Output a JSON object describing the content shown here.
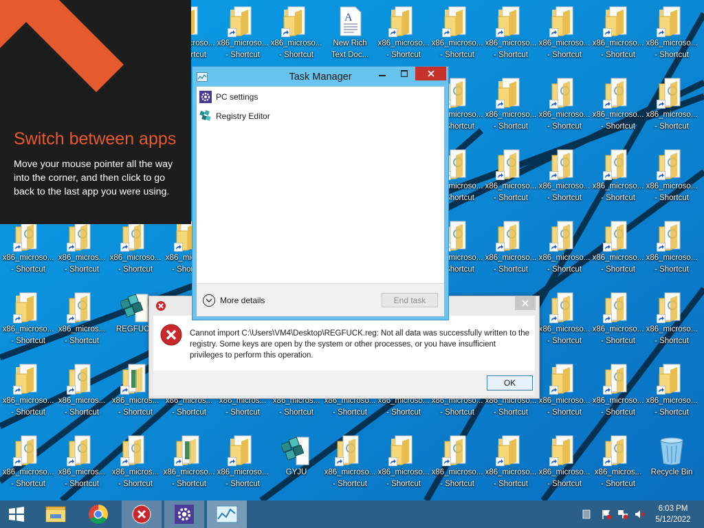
{
  "desktop": {
    "shortcut_label": "x86_microso...",
    "shortcut_label_alt": "x86_micros...",
    "shortcut_suffix": "- Shortcut",
    "icons": {
      "new_rich_text": [
        "New Rich",
        "Text Doc..."
      ],
      "regfuck": "REGFUCK",
      "gyju": "GYJU",
      "recycle_bin": "Recycle Bin"
    }
  },
  "charm_tip": {
    "title": "Switch between apps",
    "body": "Move your mouse pointer all the way into the corner, and then click to go back to the last app you were using.",
    "arrow_color": "#e55a2e"
  },
  "task_manager": {
    "title": "Task Manager",
    "apps": [
      "PC settings",
      "Registry Editor"
    ],
    "more_details": "More details",
    "end_task": "End task"
  },
  "error_dialog": {
    "message": "Cannot import C:\\Users\\VM4\\Desktop\\REGFUCK.reg: Not all data was successfully written to the registry.  Some keys are open by the system or other processes, or you have insufficient privileges to perform this operation.",
    "ok": "OK"
  },
  "taskbar": {
    "apps": [
      "start-icon",
      "file-explorer-icon",
      "chrome-icon",
      "error-app-icon",
      "pc-settings-icon",
      "task-manager-icon"
    ],
    "time": "6:03 PM",
    "date": "5/12/2022",
    "color": "#2b5f87"
  }
}
